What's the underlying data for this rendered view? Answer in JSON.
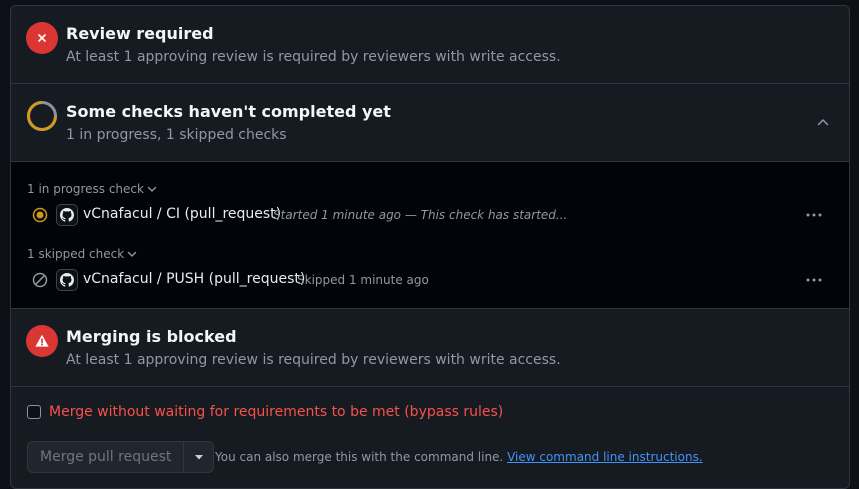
{
  "review": {
    "title": "Review required",
    "subtitle": "At least 1 approving review is required by reviewers with write access.",
    "icon": "x-circle-icon",
    "color": "#da3633"
  },
  "checks": {
    "title": "Some checks haven't completed yet",
    "subtitle": "1 in progress, 1 skipped checks",
    "icon": "progress-ring-icon",
    "progress_color": "#d29922"
  },
  "check_groups": {
    "in_progress_label": "1 in progress check",
    "skipped_label": "1 skipped check",
    "in_progress_item": {
      "name": "vCnafacul / CI (pull_request)",
      "description": "Started 1 minute ago — This check has started...",
      "status_icon": "pending-dot-icon"
    },
    "skipped_item": {
      "name": "vCnafacul / PUSH (pull_request)",
      "description": "Skipped 1 minute ago",
      "status_icon": "skip-icon"
    }
  },
  "blocked": {
    "title": "Merging is blocked",
    "subtitle": "At least 1 approving review is required by reviewers with write access.",
    "icon": "alert-icon",
    "color": "#da3633"
  },
  "merge": {
    "bypass_label": "Merge without waiting for requirements to be met (bypass rules)",
    "button_label": "Merge pull request",
    "note": "You can also merge this with the command line.",
    "link": "View command line instructions."
  }
}
